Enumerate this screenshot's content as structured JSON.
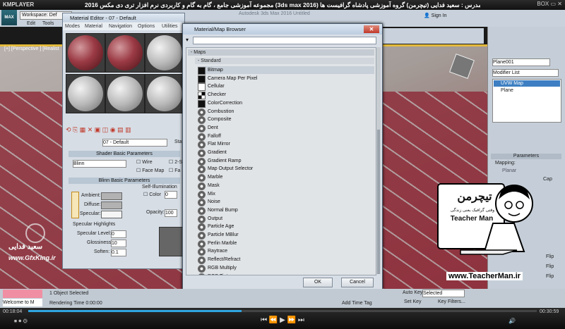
{
  "kmplayer": {
    "logo": "KMPLAYER",
    "caption": "مجموعه آموزشی جامع ، گام به گام و کاربردی نرم افزار تری دی مکس 2016 (3ds max 2016) مدرس : سعید فدایی (تیچرمن) گروه آموزشی پادشاه گرافیست ها",
    "box_label": "BOX",
    "time_elapsed": "00:18:04",
    "time_total": "00:30:59",
    "progress_fraction": 0.42
  },
  "max": {
    "workspace": "Workspace: Def",
    "menus": [
      "Edit",
      "Tools"
    ],
    "viewport_label": "[+] [Perspective ] [Realist",
    "sign_in": "Sign In",
    "window_title_faded": "Autodesk 3ds Max 2016   Untitled"
  },
  "material_editor": {
    "title": "Material Editor - 07 - Default",
    "menus": [
      "Modes",
      "Material",
      "Navigation",
      "Options",
      "Utilities"
    ],
    "material_name": "07 - Default",
    "standard_btn": "Sta",
    "shader_basic": "Shader Basic Parameters",
    "shader_type": "Blinn",
    "wire": "Wire",
    "two_sided": "2-Si",
    "face_map": "Face Map",
    "faceted": "Fa",
    "blinn_basic": "Blinn Basic Parameters",
    "self_illum": "Self-Illumination",
    "color_label": "Color",
    "color_value": "0",
    "ambient": "Ambient:",
    "diffuse": "Diffuse:",
    "specular": "Specular:",
    "opacity_label": "Opacity:",
    "opacity_value": "100",
    "specular_highlights": "Specular Highlights",
    "spec_level": "Specular Level:",
    "spec_level_val": "0",
    "glossiness": "Glossiness:",
    "glossiness_val": "10",
    "soften": "Soften:",
    "soften_val": "0.1"
  },
  "browser": {
    "title": "Material/Map Browser",
    "group_maps": "- Maps",
    "group_standard": "- Standard",
    "items": [
      {
        "label": "Bitmap",
        "icon": "black"
      },
      {
        "label": "Camera Map Per Pixel",
        "icon": "black"
      },
      {
        "label": "Cellular",
        "icon": "white"
      },
      {
        "label": "Checker",
        "icon": "checker"
      },
      {
        "label": "ColorCorrection",
        "icon": "black"
      },
      {
        "label": "Combustion",
        "icon": "cog"
      },
      {
        "label": "Composite",
        "icon": "cog"
      },
      {
        "label": "Dent",
        "icon": "cog"
      },
      {
        "label": "Falloff",
        "icon": "cog"
      },
      {
        "label": "Flat Mirror",
        "icon": "cog"
      },
      {
        "label": "Gradient",
        "icon": "cog"
      },
      {
        "label": "Gradient Ramp",
        "icon": "cog"
      },
      {
        "label": "Map Output Selector",
        "icon": "cog"
      },
      {
        "label": "Marble",
        "icon": "cog"
      },
      {
        "label": "Mask",
        "icon": "cog"
      },
      {
        "label": "Mix",
        "icon": "cog"
      },
      {
        "label": "Noise",
        "icon": "cog"
      },
      {
        "label": "Normal Bump",
        "icon": "cog"
      },
      {
        "label": "Output",
        "icon": "cog"
      },
      {
        "label": "Particle Age",
        "icon": "cog"
      },
      {
        "label": "Particle MBlur",
        "icon": "cog"
      },
      {
        "label": "Perlin Marble",
        "icon": "cog"
      },
      {
        "label": "Raytrace",
        "icon": "cog"
      },
      {
        "label": "Reflect/Refract",
        "icon": "cog"
      },
      {
        "label": "RGB Multiply",
        "icon": "cog"
      },
      {
        "label": "RGB Tint",
        "icon": "cog"
      }
    ],
    "ok": "OK",
    "cancel": "Cancel"
  },
  "command_panel": {
    "object_name": "Plane001",
    "modifier_list": "Modifier List",
    "stack_top": "UVW Map",
    "stack_base": "Plane",
    "parameters": "Parameters",
    "mapping": "Mapping:",
    "planar": "Planar",
    "cap": "Cap",
    "flip": "Flip"
  },
  "status": {
    "selected": "1 Object Selected",
    "rendering": "Rendering Time  0:00:00",
    "add_time_tag": "Add Time Tag",
    "auto_key": "Auto Key",
    "set_key": "Set Key",
    "selected_dropdown": "Selected",
    "key_filters": "Key Filters...",
    "welcome": "Welcome to M"
  },
  "watermarks": {
    "teacherman_fa": "تیچرمن",
    "teacherman_sub": "وقتی گرافیک یعنی زندگی",
    "teacherman_en": "Teacher Man",
    "url": "www.TeacherMan.ir",
    "gfx_name": "سعید فدایی",
    "gfx_url": "www.GfxKing.ir"
  },
  "colors": {
    "accent": "#2fa6e0",
    "floor": "#8f2f3c",
    "close": "#c0392b"
  }
}
